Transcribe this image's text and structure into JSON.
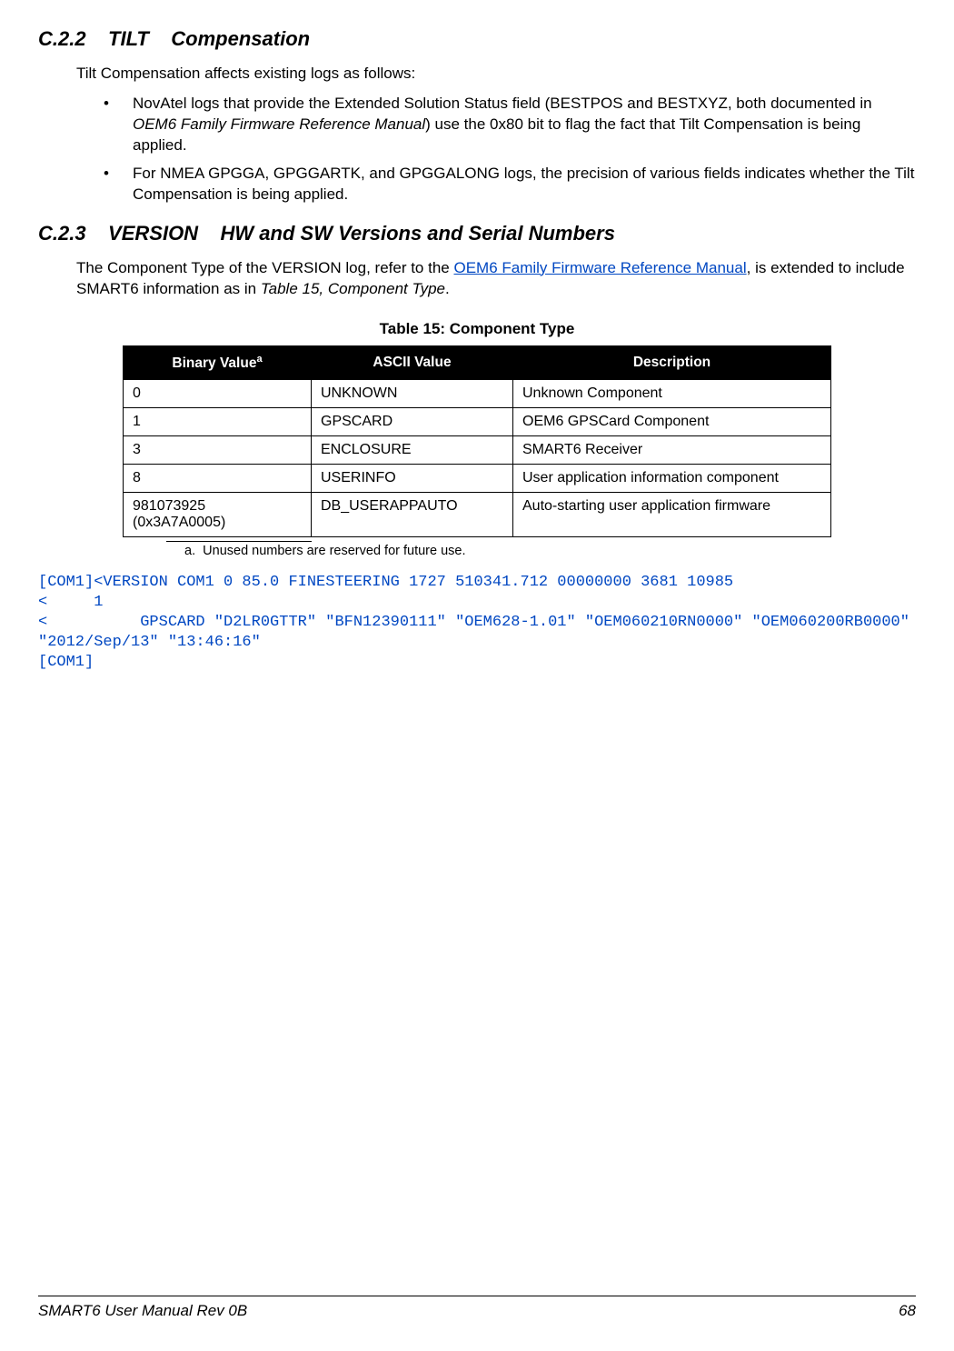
{
  "section_c22": {
    "number": "C.2.2",
    "title_main": "TILT",
    "title_sub": "Compensation",
    "intro": "Tilt Compensation affects existing logs as follows:",
    "bullets": [
      {
        "pre": "NovAtel logs that provide the Extended Solution Status field (BESTPOS and BESTXYZ, both documented in ",
        "italic": "OEM6 Family Firmware Reference Manual",
        "post": ") use the 0x80 bit to flag the fact that Tilt Compensation is being applied."
      },
      {
        "pre": "For NMEA GPGGA, GPGGARTK, and GPGGALONG logs, the precision of various fields indicates whether the Tilt Compensation is being applied.",
        "italic": "",
        "post": ""
      }
    ]
  },
  "section_c23": {
    "number": "C.2.3",
    "title_main": "VERSION",
    "title_sub": "HW and SW Versions and Serial Numbers",
    "para_pre": "The Component Type of the VERSION log, refer to the ",
    "para_link": "OEM6 Family Firmware Reference Manual",
    "para_mid": ", is extended to include SMART6 information as in ",
    "para_ref": "Table 15, Component Type",
    "para_post": "."
  },
  "table": {
    "caption": "Table 15:  Component Type",
    "headers": {
      "bin": "Binary Value",
      "bin_sup": "a",
      "asc": "ASCII Value",
      "desc": "Description"
    },
    "rows": [
      {
        "bin": "0",
        "asc": "UNKNOWN",
        "desc": "Unknown Component"
      },
      {
        "bin": "1",
        "asc": "GPSCARD",
        "desc": "OEM6 GPSCard Component"
      },
      {
        "bin": "3",
        "asc": "ENCLOSURE",
        "desc": "SMART6 Receiver"
      },
      {
        "bin": "8",
        "asc": "USERINFO",
        "desc": "User application information component"
      },
      {
        "bin": "981073925 (0x3A7A0005)",
        "asc": "DB_USERAPPAUTO",
        "desc": "Auto-starting user application firmware"
      }
    ],
    "footnote_label": "a.",
    "footnote_text": "Unused numbers are reserved for future use."
  },
  "terminal": {
    "line1": "[COM1]<VERSION COM1 0 85.0 FINESTEERING 1727 510341.712 00000000 3681 10985",
    "line2": "<     1",
    "line3": "<          GPSCARD \"D2LR0GTTR\" \"BFN12390111\" \"OEM628-1.01\" \"OEM060210RN0000\" \"OEM060200RB0000\" \"2012/Sep/13\" \"13:46:16\"",
    "line4": "[COM1]"
  },
  "footer": {
    "left": "SMART6 User Manual Rev 0B",
    "right": "68"
  }
}
